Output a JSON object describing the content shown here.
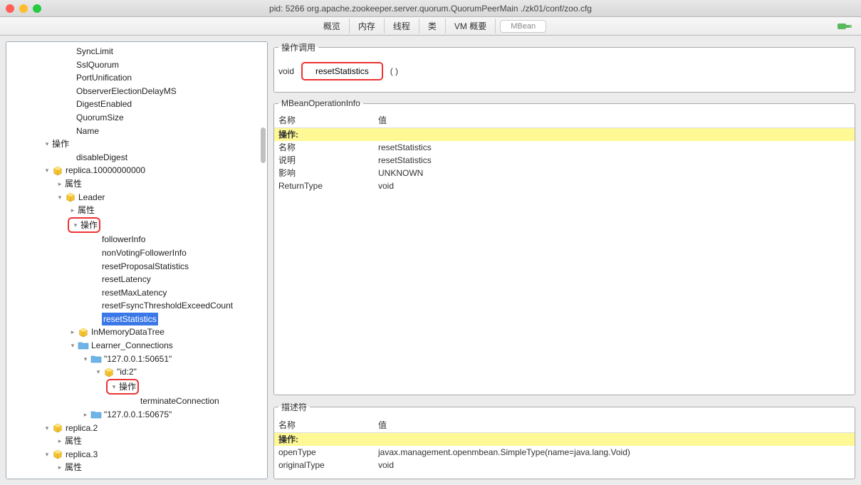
{
  "window": {
    "title": "pid: 5266 org.apache.zookeeper.server.quorum.QuorumPeerMain ./zk01/conf/zoo.cfg"
  },
  "tabs": {
    "overview": "概览",
    "memory": "内存",
    "threads": "线程",
    "classes": "类",
    "vm": "VM 概要",
    "mbean": "MBean"
  },
  "tree": {
    "syncLimit": "SyncLimit",
    "sslQuorum": "SslQuorum",
    "portUnification": "PortUnification",
    "observerElectionDelay": "ObserverElectionDelayMS",
    "digestEnabled": "DigestEnabled",
    "quorumSize": "QuorumSize",
    "name": "Name",
    "ops": "操作",
    "disableDigest": "disableDigest",
    "replica1": "replica.10000000000",
    "attrs": "属性",
    "leader": "Leader",
    "followerInfo": "followerInfo",
    "nonVotingFollowerInfo": "nonVotingFollowerInfo",
    "resetProposal": "resetProposalStatistics",
    "resetLatency": "resetLatency",
    "resetMaxLatency": "resetMaxLatency",
    "resetFsync": "resetFsyncThresholdExceedCount",
    "resetStats": "resetStatistics",
    "inMemoryDataTree": "InMemoryDataTree",
    "learnerConn": "Learner_Connections",
    "ip1": "\"127.0.0.1:50651\"",
    "id2": "\"id:2\"",
    "terminateConn": "terminateConnection",
    "ip2": "\"127.0.0.1:50675\"",
    "replica2": "replica.2",
    "replica3": "replica.3"
  },
  "invoke": {
    "title": "操作调用",
    "returnType": "void",
    "button": "resetStatistics",
    "parens": "( )"
  },
  "mbeanInfo": {
    "title": "MBeanOperationInfo",
    "headName": "名称",
    "headValue": "值",
    "group": "操作:",
    "rows": [
      {
        "name": "名称",
        "value": "resetStatistics"
      },
      {
        "name": "说明",
        "value": "resetStatistics"
      },
      {
        "name": "影响",
        "value": "UNKNOWN"
      },
      {
        "name": "ReturnType",
        "value": "void"
      }
    ]
  },
  "descriptor": {
    "title": "描述符",
    "headName": "名称",
    "headValue": "值",
    "group": "操作:",
    "rows": [
      {
        "name": "openType",
        "value": "javax.management.openmbean.SimpleType(name=java.lang.Void)"
      },
      {
        "name": "originalType",
        "value": "void"
      }
    ]
  }
}
